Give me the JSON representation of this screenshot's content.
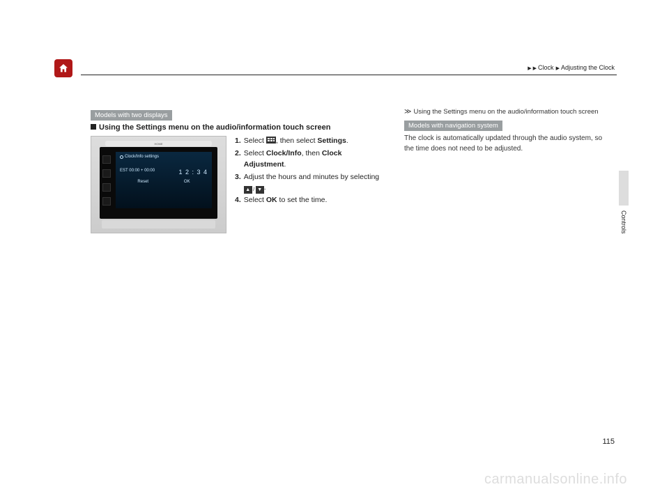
{
  "breadcrumb": {
    "part1": "Clock",
    "part2": "Adjusting the Clock"
  },
  "left": {
    "tag": "Models with two displays",
    "heading": "Using the Settings menu on the audio/information touch screen",
    "device": {
      "home_label": "HOME",
      "screen_title": "Clock/Info settings",
      "line_left": "EST 00:00 + 00:00",
      "line_right": "1 2 : 3 4",
      "btn_reset": "Reset",
      "btn_ok": "OK"
    },
    "steps": {
      "s1a": "Select ",
      "s1b": ", then select ",
      "s1c": "Settings",
      "s1d": ".",
      "s2a": "Select ",
      "s2b": "Clock/Info",
      "s2c": ", then ",
      "s2d": "Clock Adjustment",
      "s2e": ".",
      "s3a": "Adjust the hours and minutes by selecting ",
      "s3b": ".",
      "s4a": "Select ",
      "s4b": "OK",
      "s4c": " to set the time."
    }
  },
  "right": {
    "ref": "Using the Settings menu on the audio/information touch screen",
    "tag": "Models with navigation system",
    "note": "The clock is automatically updated through the audio system, so the time does not need to be adjusted."
  },
  "side_label": "Controls",
  "page_number": "115",
  "watermark": "carmanualsonline.info"
}
